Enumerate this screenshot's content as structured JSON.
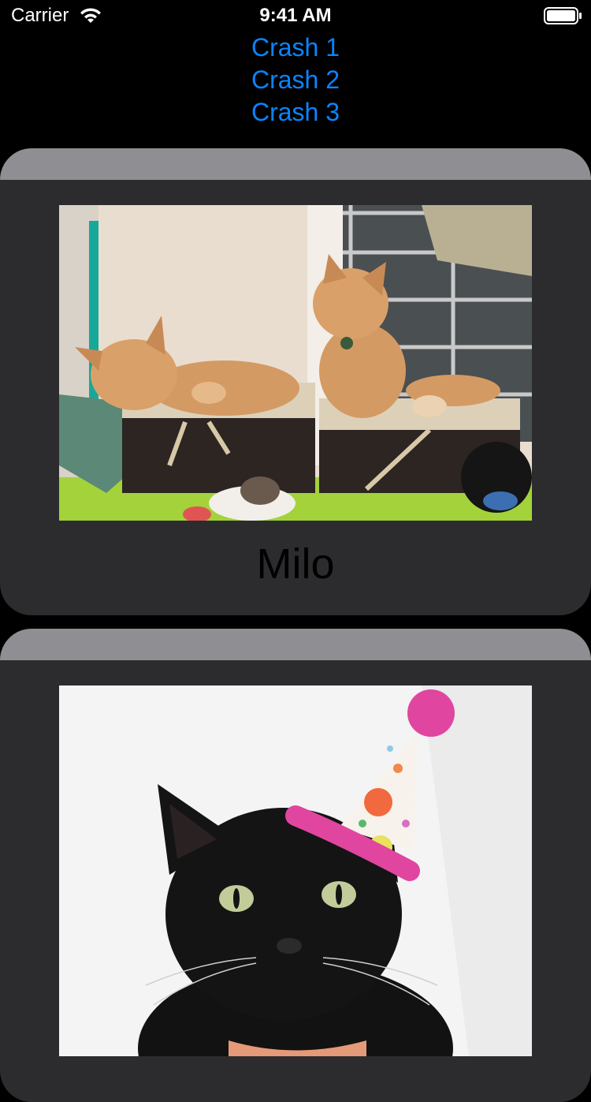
{
  "status_bar": {
    "carrier": "Carrier",
    "time": "9:41 AM",
    "wifi_icon": "wifi-icon",
    "battery_icon": "battery-icon"
  },
  "crash_buttons": [
    "Crash 1",
    "Crash 2",
    "Crash 3"
  ],
  "cards": [
    {
      "name": "Milo",
      "photo": "two orange tabby cats sitting in wicker baskets"
    },
    {
      "name": "",
      "photo": "black cat wearing a pink party hat"
    }
  ],
  "colors": {
    "background": "#000000",
    "link_blue": "#0a84ff",
    "card_background": "#2c2c2e",
    "card_header": "#8e8e93",
    "title_text": "#000000"
  }
}
